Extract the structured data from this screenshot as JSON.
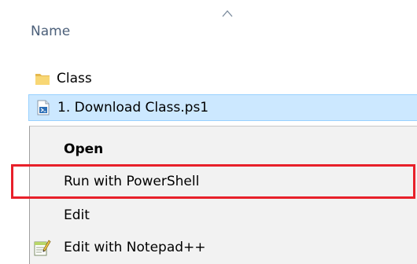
{
  "header": {
    "name_column": "Name",
    "sort_indicator": "sort-ascending-icon"
  },
  "files": [
    {
      "name": "Class",
      "icon": "folder-icon",
      "selected": false
    },
    {
      "name": "1. Download Class.ps1",
      "icon": "powershell-script-icon",
      "selected": true
    }
  ],
  "context_menu": {
    "items": [
      {
        "label": "Open",
        "bold": true
      },
      {
        "label": "Run with PowerShell",
        "highlighted": true
      },
      {
        "label": "Edit"
      },
      {
        "label": "Edit with Notepad++",
        "icon": "notepad-plus-plus-icon"
      }
    ]
  },
  "colors": {
    "selection_bg": "#cce8ff",
    "selection_border": "#99d1ff",
    "menu_bg": "#f2f2f2",
    "highlight_border": "#e8202a",
    "header_text": "#4c607a",
    "folder_yellow": "#f8d775"
  }
}
